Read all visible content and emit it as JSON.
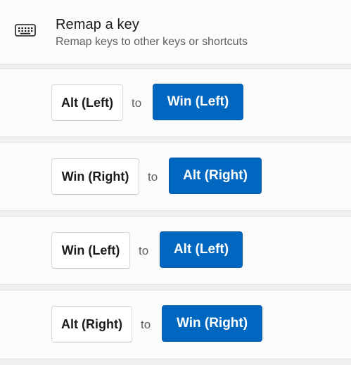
{
  "header": {
    "icon": "keyboard-icon",
    "title": "Remap a key",
    "subtitle": "Remap keys to other keys or shortcuts"
  },
  "colors": {
    "accent": "#0067c0",
    "background": "#f0f0f0",
    "card": "#fbfbfb"
  },
  "mappings": [
    {
      "from": "Alt (Left)",
      "to_label": "to",
      "to": "Win (Left)"
    },
    {
      "from": "Win (Right)",
      "to_label": "to",
      "to": "Alt (Right)"
    },
    {
      "from": "Win (Left)",
      "to_label": "to",
      "to": "Alt (Left)"
    },
    {
      "from": "Alt (Right)",
      "to_label": "to",
      "to": "Win (Right)"
    }
  ]
}
